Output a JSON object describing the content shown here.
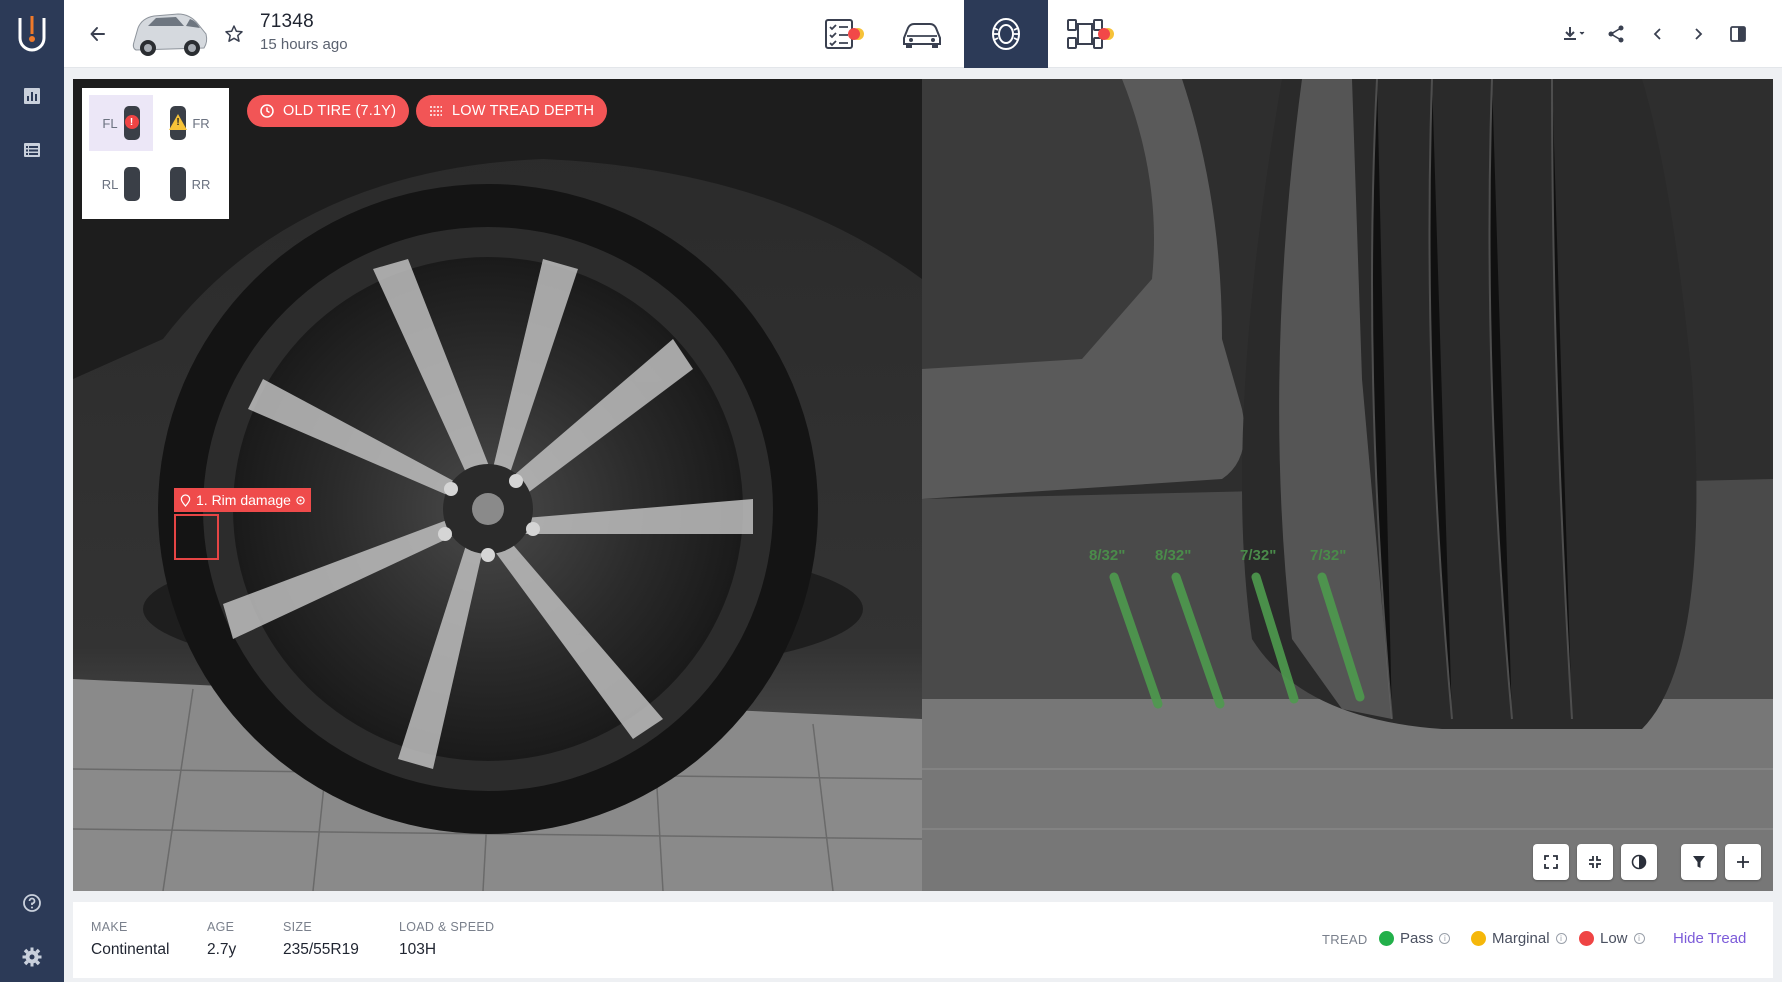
{
  "header": {
    "title": "71348",
    "subtitle": "15 hours ago"
  },
  "colors": {
    "sidebar": "#2c3a57",
    "alert": "#f25556",
    "accent_purple": "#7c5bd9",
    "pass": "#22b04a",
    "marginal": "#f5b70a",
    "low": "#ef4444"
  },
  "nav_tabs": [
    {
      "name": "checklist",
      "icon": "checklist-icon",
      "badge": true
    },
    {
      "name": "vehicle",
      "icon": "car-icon",
      "badge": false
    },
    {
      "name": "tires",
      "icon": "tire-icon",
      "badge": false,
      "active": true
    },
    {
      "name": "undercarriage",
      "icon": "chassis-icon",
      "badge": true
    }
  ],
  "tire_selector": {
    "fl": "FL",
    "fr": "FR",
    "rl": "RL",
    "rr": "RR",
    "fl_badge": "!",
    "fr_badge": "!"
  },
  "alerts": {
    "old_tire": "OLD TIRE (7.1Y)",
    "low_tread": "LOW TREAD DEPTH"
  },
  "damage": {
    "label": "1. Rim damage"
  },
  "tread_readings": {
    "r1": "8/32\"",
    "r2": "8/32\"",
    "r3": "7/32\"",
    "r4": "7/32\""
  },
  "specs": {
    "make_label": "MAKE",
    "make_value": "Continental",
    "age_label": "AGE",
    "age_value": "2.7y",
    "size_label": "SIZE",
    "size_value": "235/55R19",
    "load_label": "LOAD & SPEED",
    "load_value": "103H"
  },
  "legend": {
    "title": "TREAD",
    "pass": "Pass",
    "marginal": "Marginal",
    "low": "Low",
    "hide": "Hide Tread"
  }
}
